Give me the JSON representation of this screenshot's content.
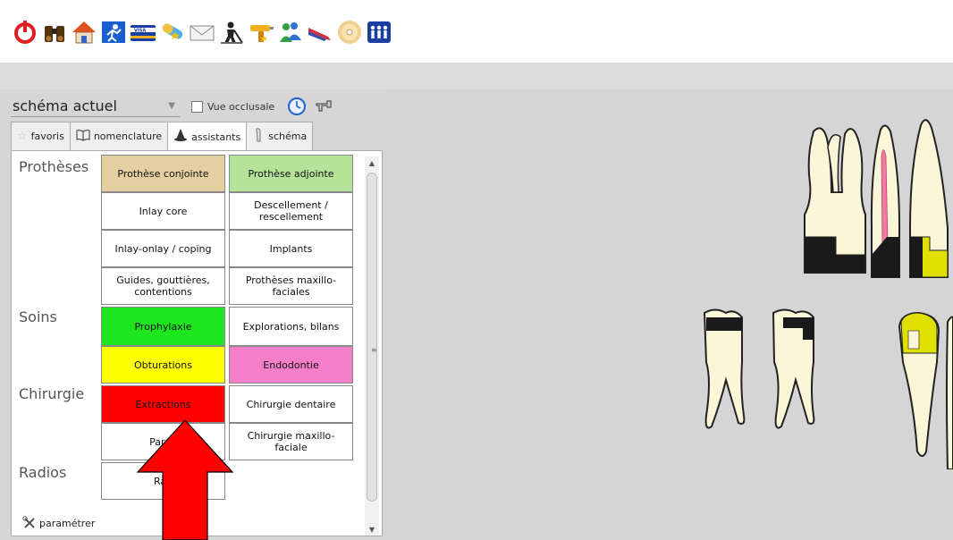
{
  "toolbar": {
    "icons": [
      "power-icon",
      "binoculars-icon",
      "home-icon",
      "runner-icon",
      "visa-card-icon",
      "pill-icon",
      "envelope-icon",
      "worker-icon",
      "drill-icon",
      "people-icon",
      "pen-icon",
      "cd-icon",
      "group-icon"
    ]
  },
  "schema": {
    "selected": "schéma actuel",
    "vue_occlusale": "Vue occlusale"
  },
  "tabs": [
    {
      "label": "favoris"
    },
    {
      "label": "nomenclature"
    },
    {
      "label": "assistants"
    },
    {
      "label": "schéma"
    }
  ],
  "categories": {
    "protheses": "Prothèses",
    "soins": "Soins",
    "chirurgie": "Chirurgie",
    "radios": "Radios"
  },
  "cells": {
    "prothese_conjointe": "Prothèse conjointe",
    "prothese_adjointe": "Prothèse adjointe",
    "inlay_core": "Inlay core",
    "descellement": "Descellement / rescellement",
    "inlay_onlay": "Inlay-onlay / coping",
    "implants": "Implants",
    "guides": "Guides, gouttières, contentions",
    "protheses_maxillo": "Prothèses maxillo-faciales",
    "prophylaxie": "Prophylaxie",
    "explorations": "Explorations, bilans",
    "obturations": "Obturations",
    "endodontie": "Endodontie",
    "extractions": "Extractions",
    "chirurgie_dentaire": "Chirurgie dentaire",
    "parodontie": "Parod",
    "chirurgie_maxillo": "Chirurgie maxillo-faciale",
    "radios": "Rad"
  },
  "footer": {
    "parametrer": "paramétrer"
  },
  "colors": {
    "prothese_conjointe": "#e3cfa0",
    "prothese_adjointe": "#b5e39a",
    "prophylaxie": "#1ee61e",
    "obturations": "#ffff00",
    "endodontie": "#f47ec8",
    "extractions": "#ff0000",
    "arrow": "#ff0000",
    "tooth": "#fbf6d8",
    "filling_black": "#1a1a1a",
    "filling_yellow": "#e0e000",
    "canal_pink": "#f07aa0"
  }
}
